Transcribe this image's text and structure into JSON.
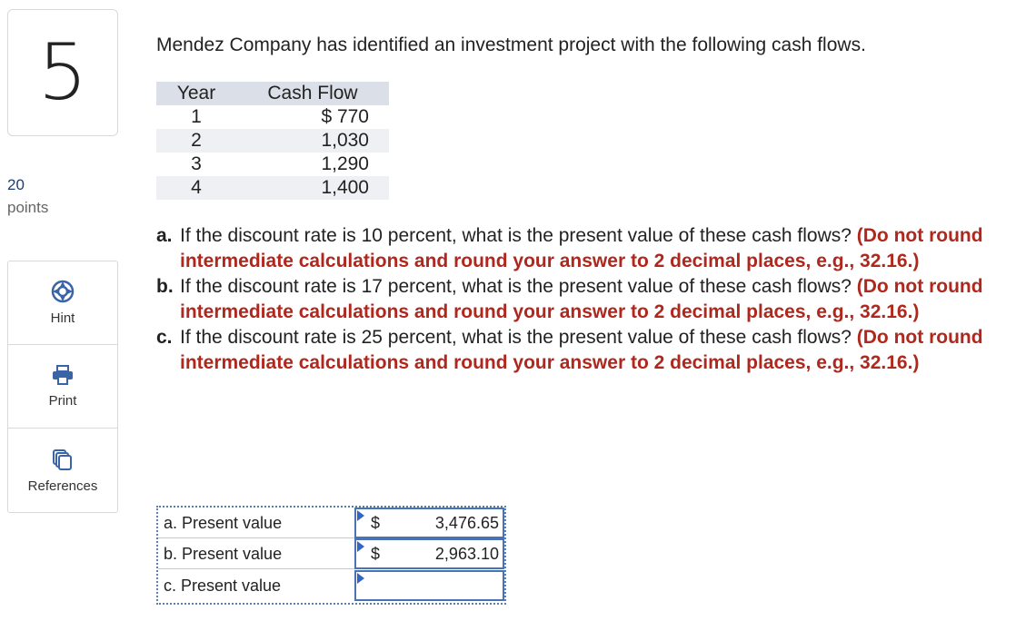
{
  "question": {
    "number": "5",
    "points_value": "20",
    "points_label": "points"
  },
  "tools": {
    "hint_label": "Hint",
    "print_label": "Print",
    "references_label": "References"
  },
  "problem": {
    "intro": "Mendez Company has identified an investment project with the following cash flows.",
    "table": {
      "headers": [
        "Year",
        "Cash Flow"
      ],
      "rows": [
        {
          "year": "1",
          "cash_flow": "$ 770"
        },
        {
          "year": "2",
          "cash_flow": "1,030"
        },
        {
          "year": "3",
          "cash_flow": "1,290"
        },
        {
          "year": "4",
          "cash_flow": "1,400"
        }
      ]
    },
    "parts": [
      {
        "label": "a.",
        "text": "If the discount rate is 10 percent, what is the present value of these cash flows? ",
        "instruction": "(Do not round intermediate calculations and round your answer to 2 decimal places, e.g., 32.16.)"
      },
      {
        "label": "b.",
        "text": "If the discount rate is 17 percent, what is the present value of these cash flows? ",
        "instruction": "(Do not round intermediate calculations and round your answer to 2 decimal places, e.g., 32.16.)"
      },
      {
        "label": "c.",
        "text": "If the discount rate is 25 percent, what is the present value of these cash flows? ",
        "instruction": "(Do not round intermediate calculations and round your answer to 2 decimal places, e.g., 32.16.)"
      }
    ]
  },
  "answers": [
    {
      "label": "a. Present value",
      "currency": "$",
      "value": "3,476.65"
    },
    {
      "label": "b. Present value",
      "currency": "$",
      "value": "2,963.10"
    },
    {
      "label": "c. Present value",
      "currency": "",
      "value": ""
    }
  ]
}
